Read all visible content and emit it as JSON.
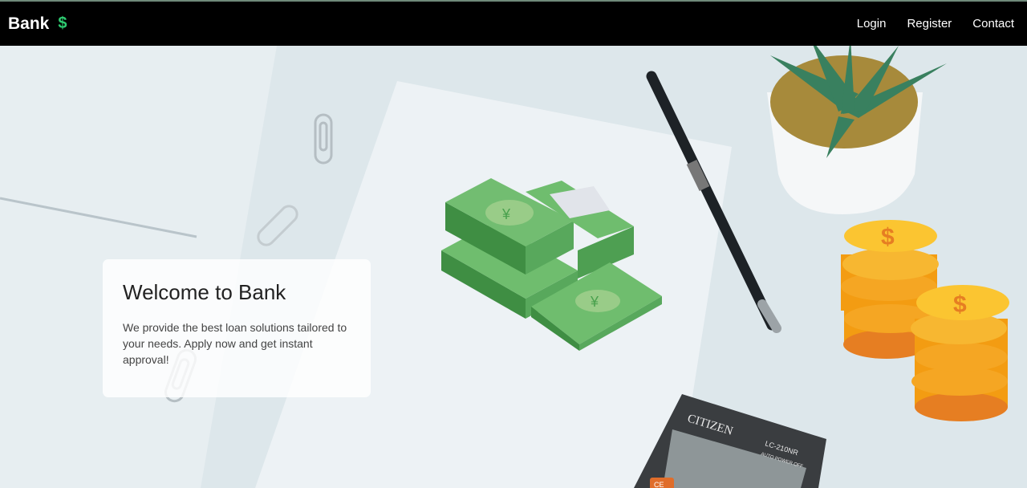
{
  "nav": {
    "brand": "Bank",
    "brand_icon": "dollar-sign-icon",
    "brand_icon_glyph": "$",
    "links": [
      "Login",
      "Register",
      "Contact"
    ]
  },
  "hero": {
    "title": "Welcome to Bank",
    "description": "We provide the best loan solutions tailored to your needs. Apply now and get instant approval!"
  },
  "illustration": {
    "banknote_symbol": "¥",
    "coin_symbol": "$",
    "calculator_brand": "CITIZEN",
    "calculator_model": "LC-210NR",
    "calculator_sub": "AUTO POWER OFF",
    "calculator_key": "CE"
  },
  "colors": {
    "navbar": "#000000",
    "brand_icon": "#2ecc71",
    "money_green": "#4aa14e",
    "coin_gold": "#f5b021"
  }
}
